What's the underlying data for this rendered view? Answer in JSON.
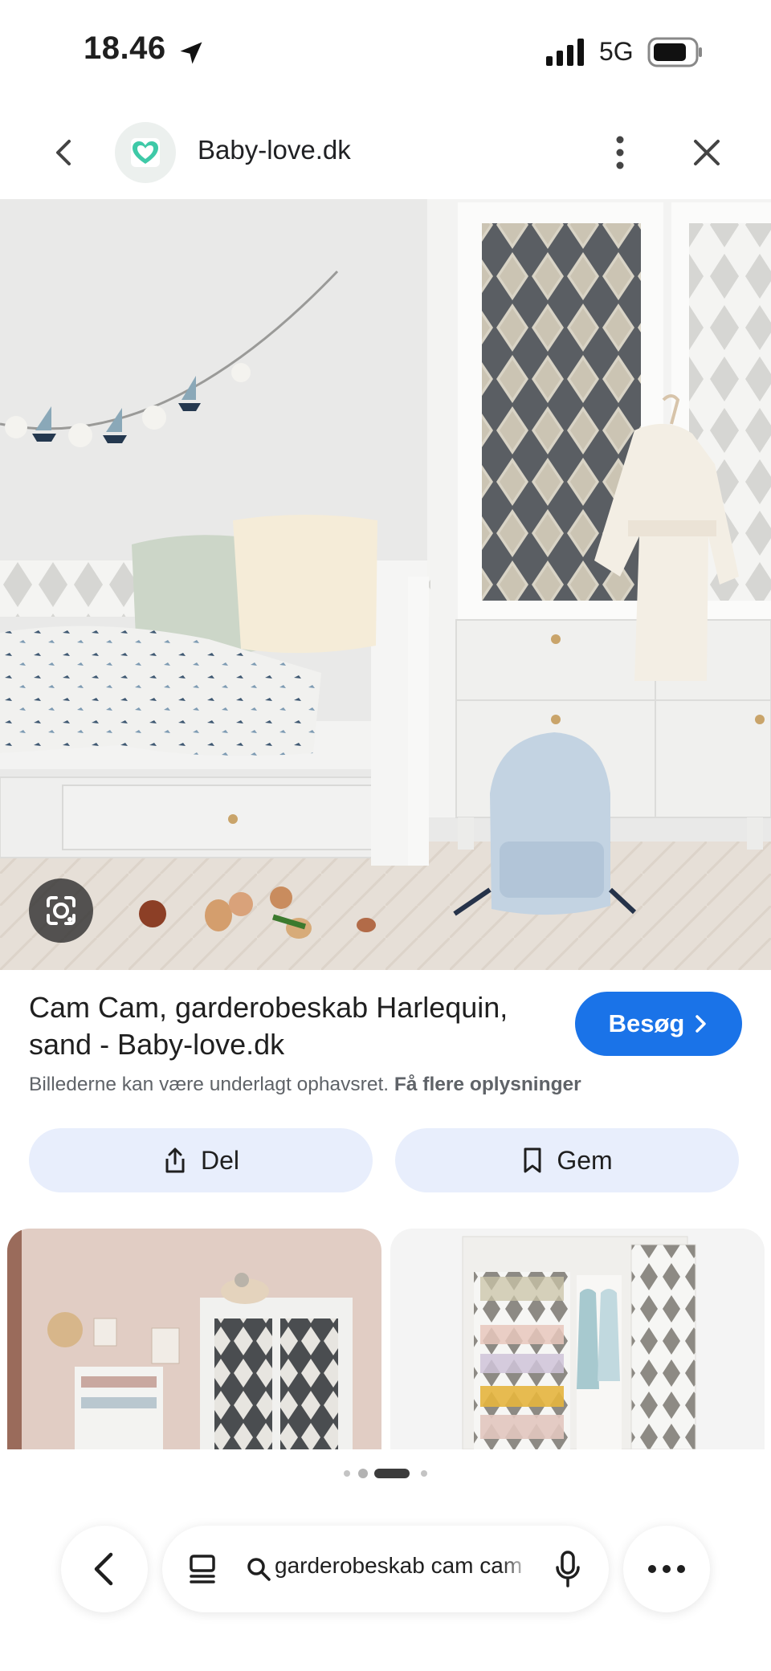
{
  "status_bar": {
    "time": "18.46",
    "network": "5G",
    "icons": [
      "location-arrow-icon",
      "signal-icon",
      "battery-icon"
    ]
  },
  "header": {
    "site_name": "Baby-love.dk",
    "icons": [
      "back-arrow-icon",
      "heart-logo-icon",
      "more-vertical-icon",
      "close-icon"
    ]
  },
  "result": {
    "title": "Cam Cam, garderobeskab Harlequin, sand - Baby-love.dk",
    "visit_label": "Besøg",
    "copyright_notice": "Billederne kan være underlagt ophavsret.",
    "more_info_link": "Få flere oplysninger",
    "share_label": "Del",
    "save_label": "Gem"
  },
  "pager": {
    "count": 4,
    "active_index": 2
  },
  "bottom_bar": {
    "search_query": "garderobeskab cam cam",
    "icons": [
      "back-icon",
      "tabs-icon",
      "search-icon",
      "microphone-icon",
      "more-horizontal-icon"
    ]
  },
  "colors": {
    "accent": "#1a73e8",
    "pill_background": "#e8eefc",
    "secondary_text": "#5f6368"
  }
}
